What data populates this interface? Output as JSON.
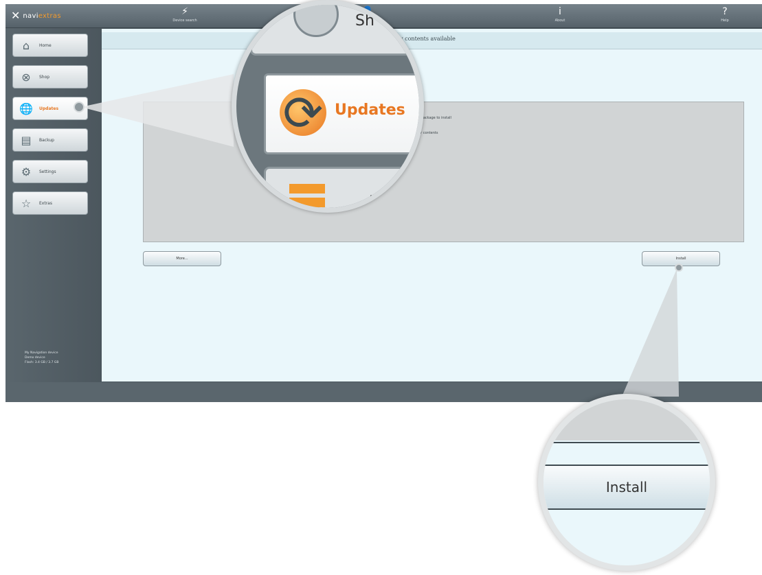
{
  "app": {
    "logo": {
      "prefix": "navi",
      "accent": "extras",
      "mark": "✕"
    }
  },
  "topnav": [
    {
      "name": "device",
      "icon": "plug-icon",
      "glyph": "⚡",
      "label": "Device search"
    },
    {
      "name": "user",
      "icon": "user-icon",
      "glyph": "👤",
      "label": ""
    },
    {
      "name": "about",
      "icon": "info-icon",
      "glyph": "i",
      "label": "About"
    },
    {
      "name": "help",
      "icon": "help-icon",
      "glyph": "?",
      "label": "Help"
    }
  ],
  "sidebar": {
    "items": [
      {
        "label": "Home",
        "icon": "home-icon",
        "glyph": "⌂"
      },
      {
        "label": "Shop",
        "icon": "shop-icon",
        "glyph": "⊗"
      },
      {
        "label": "Updates",
        "icon": "updates-icon",
        "glyph": "🌐",
        "active": true
      },
      {
        "label": "Backup",
        "icon": "backup-icon",
        "glyph": "▤"
      },
      {
        "label": "Settings",
        "icon": "settings-icon",
        "glyph": "⚙"
      },
      {
        "label": "Extras",
        "icon": "extras-icon",
        "glyph": "☆"
      }
    ],
    "device_info": [
      "My Navigation device",
      "Demo device",
      "Flash: 3.4 GB / 3.7 GB"
    ]
  },
  "content": {
    "header": "New contents available",
    "panel_lines": [
      "r package to install",
      "er contents"
    ],
    "more_button": "More...",
    "install_button": "Install"
  },
  "lens_updates": {
    "top_text": "Sh",
    "label": "Updates",
    "bottom_text": "Ba"
  },
  "lens_install": {
    "label": "Install"
  },
  "colors": {
    "accent": "#e87722",
    "content_bg": "#eaf7fb",
    "chrome": "#4a565d"
  }
}
